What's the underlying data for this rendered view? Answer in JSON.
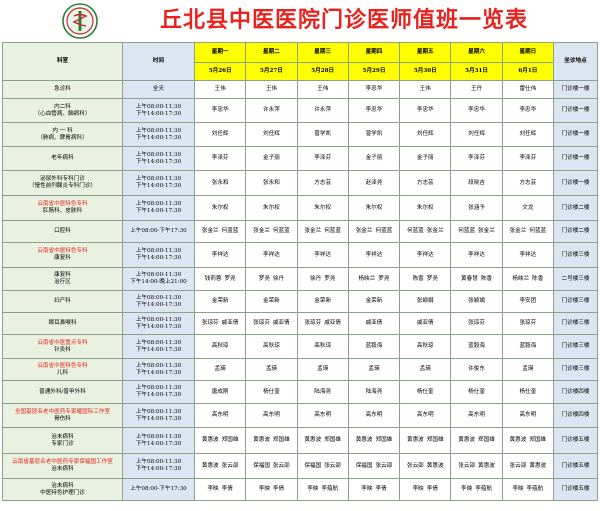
{
  "title": "丘北县中医医院门诊医师值班一览表",
  "headers": {
    "dept": "科室",
    "time": "时间",
    "loc": "坐诊地点",
    "days": [
      {
        "week": "星期一",
        "date": "5月26日"
      },
      {
        "week": "星期二",
        "date": "5月27日"
      },
      {
        "week": "星期三",
        "date": "5月28日"
      },
      {
        "week": "星期四",
        "date": "5月29日"
      },
      {
        "week": "星期五",
        "date": "5月30日"
      },
      {
        "week": "星期六",
        "date": "5月31日"
      },
      {
        "week": "星期日",
        "date": "6月1日"
      }
    ]
  },
  "rows": [
    {
      "dept": [
        "急诊科"
      ],
      "time": [
        "全天"
      ],
      "days": [
        [
          "王伟"
        ],
        [
          "王伟"
        ],
        [
          "王伟"
        ],
        [
          "李忠华"
        ],
        [
          "王伟"
        ],
        [
          "王丹"
        ],
        [
          "雷仕伟"
        ]
      ],
      "loc": "门诊楼一楼"
    },
    {
      "dept": [
        "内二科",
        "（心血管病、脑病科）"
      ],
      "time": [
        "上午08:00-11:30",
        "下午14:00-17:30"
      ],
      "days": [
        [
          "李忠华"
        ],
        [
          "许永萍"
        ],
        [
          "许永萍"
        ],
        [
          "李忠华"
        ],
        [
          "李忠华"
        ],
        [
          "李忠华"
        ],
        [
          "李忠华"
        ]
      ],
      "loc": "门诊楼一楼"
    },
    {
      "dept": [
        "内 一 科",
        "（肺病、脾胃病科）"
      ],
      "time": [
        "上午08:00-11:30",
        "下午14:00-17:30"
      ],
      "days": [
        [
          "刘任辉"
        ],
        [
          "刘任辉"
        ],
        [
          "曾学凯"
        ],
        [
          "曾学凯"
        ],
        [
          "刘任辉"
        ],
        [
          "刘任辉"
        ],
        [
          "刘任辉"
        ]
      ],
      "loc": "门诊楼一楼"
    },
    {
      "dept": [
        "老年病科"
      ],
      "time": [
        "上午08:00-11:30",
        "下午14:00-17:30"
      ],
      "days": [
        [
          "李泽芬"
        ],
        [
          "金子丽"
        ],
        [
          "李泽芬"
        ],
        [
          "金子丽"
        ],
        [
          "金子丽"
        ],
        [
          "李泽芬"
        ],
        [
          "李泽芬"
        ]
      ],
      "loc": "门诊楼一楼"
    },
    {
      "dept": [
        "泌尿外科专科门诊",
        "（慢性前列腺炎专科门诊）"
      ],
      "time": [
        "上午08:00-11:30",
        "下午14:00-17:30"
      ],
      "days": [
        [
          "张永和"
        ],
        [
          "张永和"
        ],
        [
          "方志芸"
        ],
        [
          "赵泽尧"
        ],
        [
          "方志芸"
        ],
        [
          "段晓吉"
        ],
        [
          "方志芸"
        ]
      ],
      "loc": "门诊楼一楼"
    },
    {
      "dept": [
        "云南省中医特色专科",
        "肛肠科、皮肤科"
      ],
      "deptRed": [
        true,
        false
      ],
      "time": [
        "上午08:00-11:30",
        "下午14:00-17:30"
      ],
      "days": [
        [
          "朱尔权"
        ],
        [
          "朱尔权"
        ],
        [
          "朱尔权"
        ],
        [
          "朱尔权"
        ],
        [
          "朱尔权"
        ],
        [
          "张涵予"
        ],
        [
          "文龙"
        ]
      ],
      "loc": "门诊楼二楼"
    },
    {
      "dept": [
        "口腔科"
      ],
      "time": [
        "上午08:00-下午17:30"
      ],
      "days": [
        [
          "张金兰",
          "何蓝蓝"
        ],
        [
          "张金兰",
          "何蓝蓝"
        ],
        [
          "张金兰",
          "何蓝蓝"
        ],
        [
          "张金兰",
          "何蓝蓝"
        ],
        [
          "何蓝蓝",
          "张金兰"
        ],
        [
          "何蓝蓝",
          "张金兰"
        ],
        [
          "张金兰",
          "何蓝蓝"
        ]
      ],
      "loc": "门诊楼二楼"
    },
    {
      "dept": [
        "云南省中医特色专科",
        "康复科"
      ],
      "deptRed": [
        true,
        false
      ],
      "time": [
        "上午08:00-11:30",
        "下午14:00-17:30"
      ],
      "days": [
        [
          "李祥达"
        ],
        [
          "李祥达"
        ],
        [
          "李祥达"
        ],
        [
          "李祥达"
        ],
        [
          "李祥达"
        ],
        [
          "李祥达"
        ],
        [
          "李祥达"
        ]
      ],
      "loc": "门诊楼三楼"
    },
    {
      "dept": [
        "康复科",
        "治疗区"
      ],
      "time": [
        "上午08:00-11:30",
        "下午14:00-晚上21:00"
      ],
      "days": [
        [
          "钱莉蓉",
          "罗尧"
        ],
        [
          "罗尧",
          "徐丹"
        ],
        [
          "徐丹",
          "罗尧"
        ],
        [
          "杨映兰",
          "罗尧"
        ],
        [
          "陈香",
          "罗尧"
        ],
        [
          "黄春慧",
          "陈香"
        ],
        [
          "杨映兰",
          "陈香"
        ]
      ],
      "loc": "二号楼三楼"
    },
    {
      "dept": [
        "妇产科"
      ],
      "time": [
        "上午08:00-11:30",
        "下午14:00-17:30"
      ],
      "days": [
        [
          "金荣新"
        ],
        [
          "金荣新"
        ],
        [
          "金荣新"
        ],
        [
          "金荣新"
        ],
        [
          "张颖娟"
        ],
        [
          "张颖娟"
        ],
        [
          "李安团"
        ]
      ],
      "loc": "门诊楼三楼"
    },
    {
      "dept": [
        "眼耳鼻喉科"
      ],
      "time": [
        "上午08:00-11:30",
        "下午14:00-17:30"
      ],
      "days": [
        [
          "张琼芬",
          "戚亚倩"
        ],
        [
          "张琼芬",
          "戚亚倩"
        ],
        [
          "张琼芬",
          "戚亚倩"
        ],
        [
          "戚亚倩"
        ],
        [
          "戚亚倩"
        ],
        [
          "张琼芬"
        ],
        [
          "张琼芬"
        ]
      ],
      "loc": "门诊楼三楼"
    },
    {
      "dept": [
        "云南省中医重点专科",
        "针灸科"
      ],
      "deptRed": [
        true,
        false
      ],
      "time": [
        "上午08:00-11:30",
        "下午14:00-17:30"
      ],
      "days": [
        [
          "高秋琼"
        ],
        [
          "高秋琼"
        ],
        [
          "高秋琼"
        ],
        [
          "蓝毅海"
        ],
        [
          "高秋琼"
        ],
        [
          "蓝毅海"
        ],
        [
          "蓝毅海"
        ]
      ],
      "loc": "门诊楼三楼"
    },
    {
      "dept": [
        "云南省中医特色专科",
        "儿科"
      ],
      "deptRed": [
        true,
        false
      ],
      "time": [
        "上午08:00-11:30",
        "下午14:00-17:30"
      ],
      "days": [
        [
          "孟瑛"
        ],
        [
          "孟瑛"
        ],
        [
          "孟瑛"
        ],
        [
          "孟瑛"
        ],
        [
          "孟瑛"
        ],
        [
          "许俊东"
        ],
        [
          "孟瑛"
        ]
      ],
      "loc": "门诊楼三楼"
    },
    {
      "dept": [
        "普通外科/普甲外科"
      ],
      "time": [
        "上午08:00-11:30",
        "下午14:00-17:30"
      ],
      "days": [
        [
          "唐成刚"
        ],
        [
          "杨仕奎"
        ],
        [
          "陆海尧"
        ],
        [
          "陆海尧"
        ],
        [
          "杨仕奎"
        ],
        [
          "杨仕奎"
        ],
        [
          "杨仕奎"
        ]
      ],
      "loc": "门诊楼四楼"
    },
    {
      "dept": [
        "全国基层名老中医药专家耀国际工作室",
        "骨伤科"
      ],
      "deptRed": [
        true,
        false
      ],
      "time": [
        "上午08:00-11:30",
        "下午14:00-17:30"
      ],
      "days": [
        [
          "高东明"
        ],
        [
          "高东明"
        ],
        [
          "高东明"
        ],
        [
          "高东明"
        ],
        [
          "高东明"
        ],
        [
          "高东明"
        ],
        [
          "高东明"
        ]
      ],
      "loc": "门诊楼四楼"
    },
    {
      "dept": [
        "治未病科",
        "专家门诊"
      ],
      "time": [
        "上午08:00-11:30",
        "下午14:00-17:30"
      ],
      "days": [
        [
          "黄惠波",
          "郑国雄"
        ],
        [
          "黄惠波",
          "郑国雄"
        ],
        [
          "黄惠波",
          "郑国雄"
        ],
        [
          "黄惠波",
          "郑国雄"
        ],
        [
          "黄惠波",
          "郑国雄"
        ],
        [
          "黄惠波",
          "郑国雄"
        ],
        [
          "黄惠波",
          "郑国雄"
        ]
      ],
      "loc": "门诊楼五楼"
    },
    {
      "dept": [
        "云南省基层名老中医药专家保福国工作室",
        "治未病科"
      ],
      "deptRed": [
        true,
        false
      ],
      "time": [
        "上午08:00-11:30",
        "下午14:00-17:30"
      ],
      "days": [
        [
          "黄惠波",
          "张云邵"
        ],
        [
          "保福国",
          "张云邵"
        ],
        [
          "保福国",
          "张云邵"
        ],
        [
          "保福国",
          "张云邵"
        ],
        [
          "张云邵",
          "黄惠波"
        ],
        [
          "张云邵",
          "黄惠波"
        ],
        [
          "张云邵",
          "黄惠波"
        ]
      ],
      "loc": "门诊楼五楼"
    },
    {
      "dept": [
        "治未病科",
        "中医特色护理门诊"
      ],
      "time": [
        "上午08:00-下午17:30"
      ],
      "days": [
        [
          "李映",
          "李倩"
        ],
        [
          "李映",
          "李倩"
        ],
        [
          "李映",
          "李蕴航"
        ],
        [
          "李映",
          "李倩"
        ],
        [
          "李映",
          "李倩"
        ],
        [
          "李映",
          "李蕴航"
        ],
        [
          "李映",
          "李蕴航"
        ]
      ],
      "loc": "门诊楼五楼"
    }
  ]
}
